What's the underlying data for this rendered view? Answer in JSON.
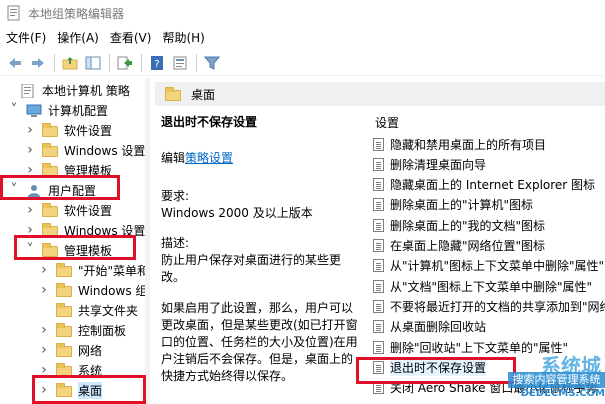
{
  "window": {
    "title": "本地组策略编辑器"
  },
  "menu": [
    "文件(F)",
    "操作(A)",
    "查看(V)",
    "帮助(H)"
  ],
  "toolbar": {
    "buttons": [
      "back-icon",
      "forward-icon",
      "folder-up-icon",
      "show-hide-tree-icon",
      "export-icon",
      "help-icon",
      "properties-icon",
      "filter-icon"
    ]
  },
  "tree": [
    {
      "label": "本地计算机 策略",
      "indent": 0,
      "chev": "",
      "icon": "policy"
    },
    {
      "label": "计算机配置",
      "indent": 1,
      "chev": "down",
      "icon": "computer"
    },
    {
      "label": "软件设置",
      "indent": 2,
      "chev": "right",
      "icon": "folder"
    },
    {
      "label": "Windows 设置",
      "indent": 2,
      "chev": "right",
      "icon": "folder"
    },
    {
      "label": "管理模板",
      "indent": 2,
      "chev": "right",
      "icon": "folder"
    },
    {
      "label": "用户配置",
      "indent": 1,
      "chev": "down",
      "icon": "user"
    },
    {
      "label": "软件设置",
      "indent": 2,
      "chev": "right",
      "icon": "folder"
    },
    {
      "label": "Windows 设置",
      "indent": 2,
      "chev": "right",
      "icon": "folder"
    },
    {
      "label": "管理模板",
      "indent": 2,
      "chev": "down",
      "icon": "folder"
    },
    {
      "label": "\"开始\"菜单和",
      "indent": 3,
      "chev": "right",
      "icon": "folder"
    },
    {
      "label": "Windows 组",
      "indent": 3,
      "chev": "right",
      "icon": "folder"
    },
    {
      "label": "共享文件夹",
      "indent": 3,
      "chev": "",
      "icon": "folder"
    },
    {
      "label": "控制面板",
      "indent": 3,
      "chev": "right",
      "icon": "folder"
    },
    {
      "label": "网络",
      "indent": 3,
      "chev": "right",
      "icon": "folder"
    },
    {
      "label": "系统",
      "indent": 3,
      "chev": "right",
      "icon": "folder"
    },
    {
      "label": "桌面",
      "indent": 3,
      "chev": "right",
      "icon": "folder",
      "selected": true
    }
  ],
  "right": {
    "header": "桌面",
    "detail": {
      "title": "退出时不保存设置",
      "edit_prefix": "编辑",
      "edit_link": "策略设置",
      "req_label": "要求:",
      "req_value": "Windows 2000 及以上版本",
      "desc_label": "描述:",
      "desc_value": "防止用户保存对桌面进行的某些更改。",
      "body": "如果启用了此设置，那么，用户可以更改桌面，但是某些更改(如已打开窗口的位置、任务栏的大小及位置)在用户注销后不会保存。但是，桌面上的快捷方式始终得以保存。"
    },
    "settings_header": "设置",
    "settings": [
      "隐藏和禁用桌面上的所有项目",
      "删除清理桌面向导",
      "隐藏桌面上的 Internet Explorer 图标",
      "删除桌面上的\"计算机\"图标",
      "删除桌面上的\"我的文档\"图标",
      "在桌面上隐藏\"网络位置\"图标",
      "从\"计算机\"图标上下文菜单中删除\"属性\"",
      "从\"文档\"图标上下文菜单中删除\"属性\"",
      "不要将最近打开的文档的共享添加到\"网络",
      "从桌面删除回收站",
      "删除\"回收站\"上下文菜单的\"属性\"",
      "退出时不保存设置",
      "关闭 Aero Shake 窗口最小化鼠标手势"
    ]
  },
  "watermark": {
    "logo": "系统城",
    "text": "搜索内容管理系统",
    "url": "DEDECMS.COM"
  }
}
